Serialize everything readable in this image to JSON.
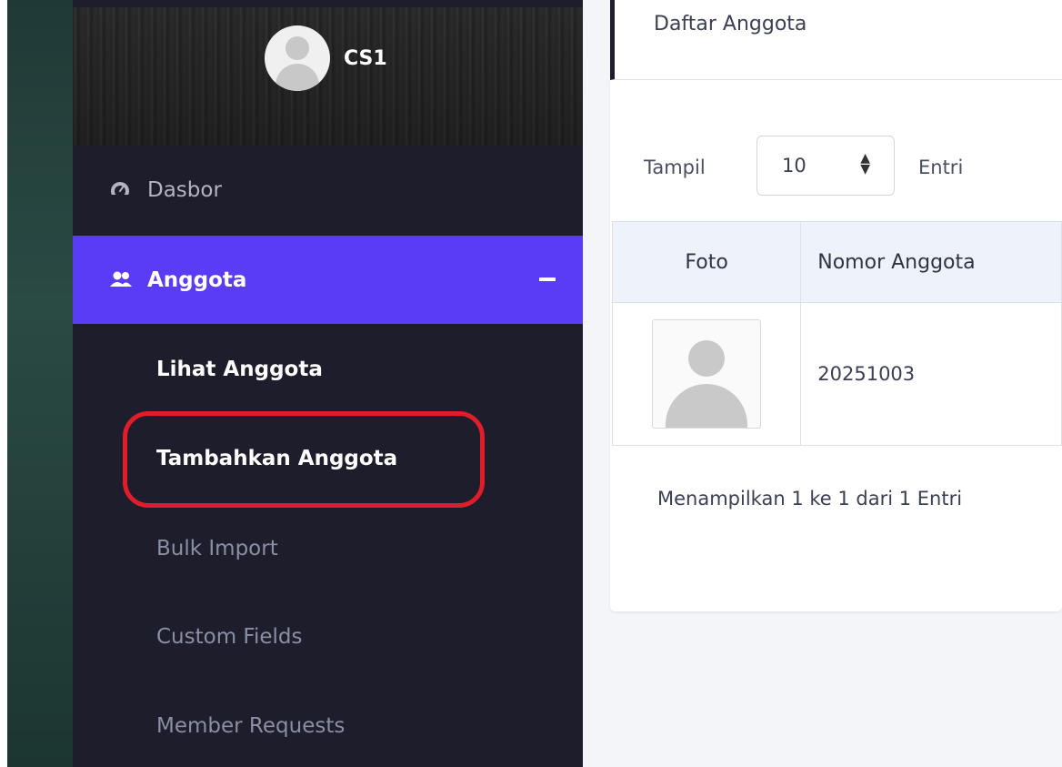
{
  "user": {
    "name": "CS1"
  },
  "sidebar": {
    "items": [
      {
        "label": "Dasbor",
        "icon": "dashboard-icon"
      },
      {
        "label": "Anggota",
        "icon": "users-icon",
        "active": true
      }
    ],
    "submenu": [
      {
        "label": "Lihat Anggota"
      },
      {
        "label": "Tambahkan Anggota",
        "highlighted": true
      },
      {
        "label": "Bulk Import"
      },
      {
        "label": "Custom Fields"
      },
      {
        "label": "Member Requests"
      }
    ]
  },
  "main": {
    "title": "Daftar Anggota",
    "length": {
      "prefix": "Tampil",
      "value": "10",
      "suffix": "Entri"
    },
    "table": {
      "columns": [
        "Foto",
        "Nomor Anggota"
      ],
      "rows": [
        {
          "member_number": "20251003"
        }
      ]
    },
    "info": "Menampilkan 1 ke 1 dari 1 Entri"
  },
  "colors": {
    "accent": "#5b3cf6",
    "sidebar": "#1e1d2b",
    "highlight": "#e11d2a"
  }
}
